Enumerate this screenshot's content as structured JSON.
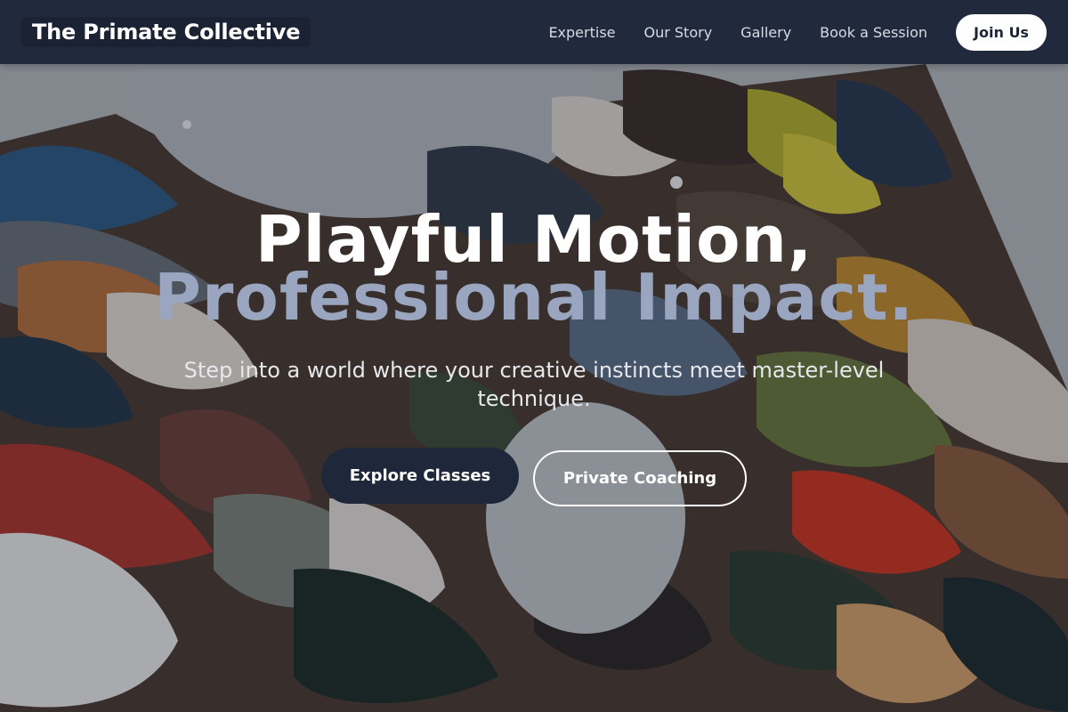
{
  "header": {
    "brand": "The Primate Collective",
    "nav": [
      "Expertise",
      "Our Story",
      "Gallery",
      "Book a Session"
    ],
    "cta_label": "Join Us"
  },
  "hero": {
    "headline_line1": "Playful Motion,",
    "headline_line2": "Professional Impact.",
    "subtitle": "Step into a world where your creative instincts meet master-level technique.",
    "primary_button": "Explore Classes",
    "secondary_button": "Private Coaching",
    "background_image": "painted-palette"
  },
  "colors": {
    "header_bg": "#212a3d",
    "accent_text": "#9aa6c0",
    "primary_button_bg": "#1f283b",
    "white": "#ffffff"
  }
}
